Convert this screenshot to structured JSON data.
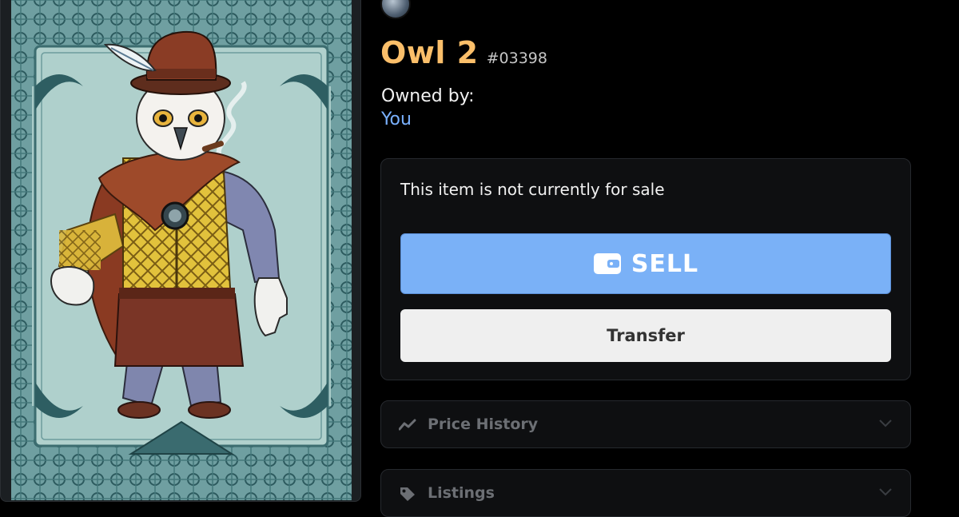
{
  "item": {
    "title": "Owl 2",
    "token_id": "#03398",
    "owned_by_label": "Owned by:",
    "owner": "You"
  },
  "sale": {
    "status": "This item is not currently for sale",
    "sell_label": "SELL",
    "sell_icon": "wallet-icon",
    "transfer_label": "Transfer"
  },
  "sections": [
    {
      "label": "Price History",
      "icon": "trend-line-icon"
    },
    {
      "label": "Listings",
      "icon": "tag-icon"
    }
  ],
  "colors": {
    "title": "#fbbf6a",
    "owner_link": "#7ab1ff",
    "sell_button": "#7ab1f7",
    "transfer_button": "#efefef",
    "card_background": "#a8c9c6"
  }
}
